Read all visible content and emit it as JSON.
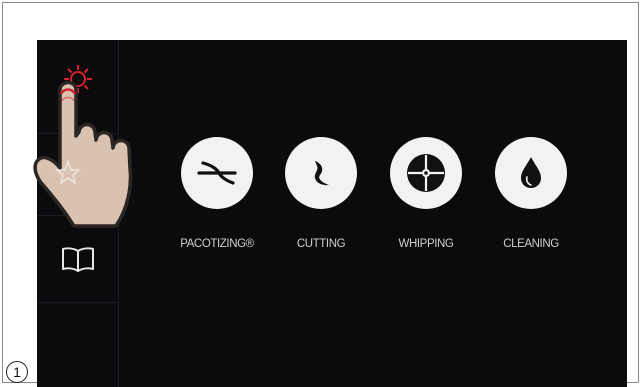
{
  "sidebar": {
    "items": [
      {
        "icon": "gear-icon",
        "color": "#d8202e"
      },
      {
        "icon": "star-icon"
      },
      {
        "icon": "book-icon"
      }
    ]
  },
  "modes": [
    {
      "label": "PACOTIZING®",
      "icon": "pacotizing-blade-icon"
    },
    {
      "label": "CUTTING",
      "icon": "cutting-blade-icon"
    },
    {
      "label": "WHIPPING",
      "icon": "whipping-disc-icon"
    },
    {
      "label": "CLEANING",
      "icon": "water-drop-icon"
    }
  ],
  "step_marker": "1",
  "colors": {
    "screen_bg": "#0b0b0d",
    "accent_red": "#d8202e",
    "circle_bg": "#f2f2f2",
    "hand_fill": "#d9c3b0"
  }
}
